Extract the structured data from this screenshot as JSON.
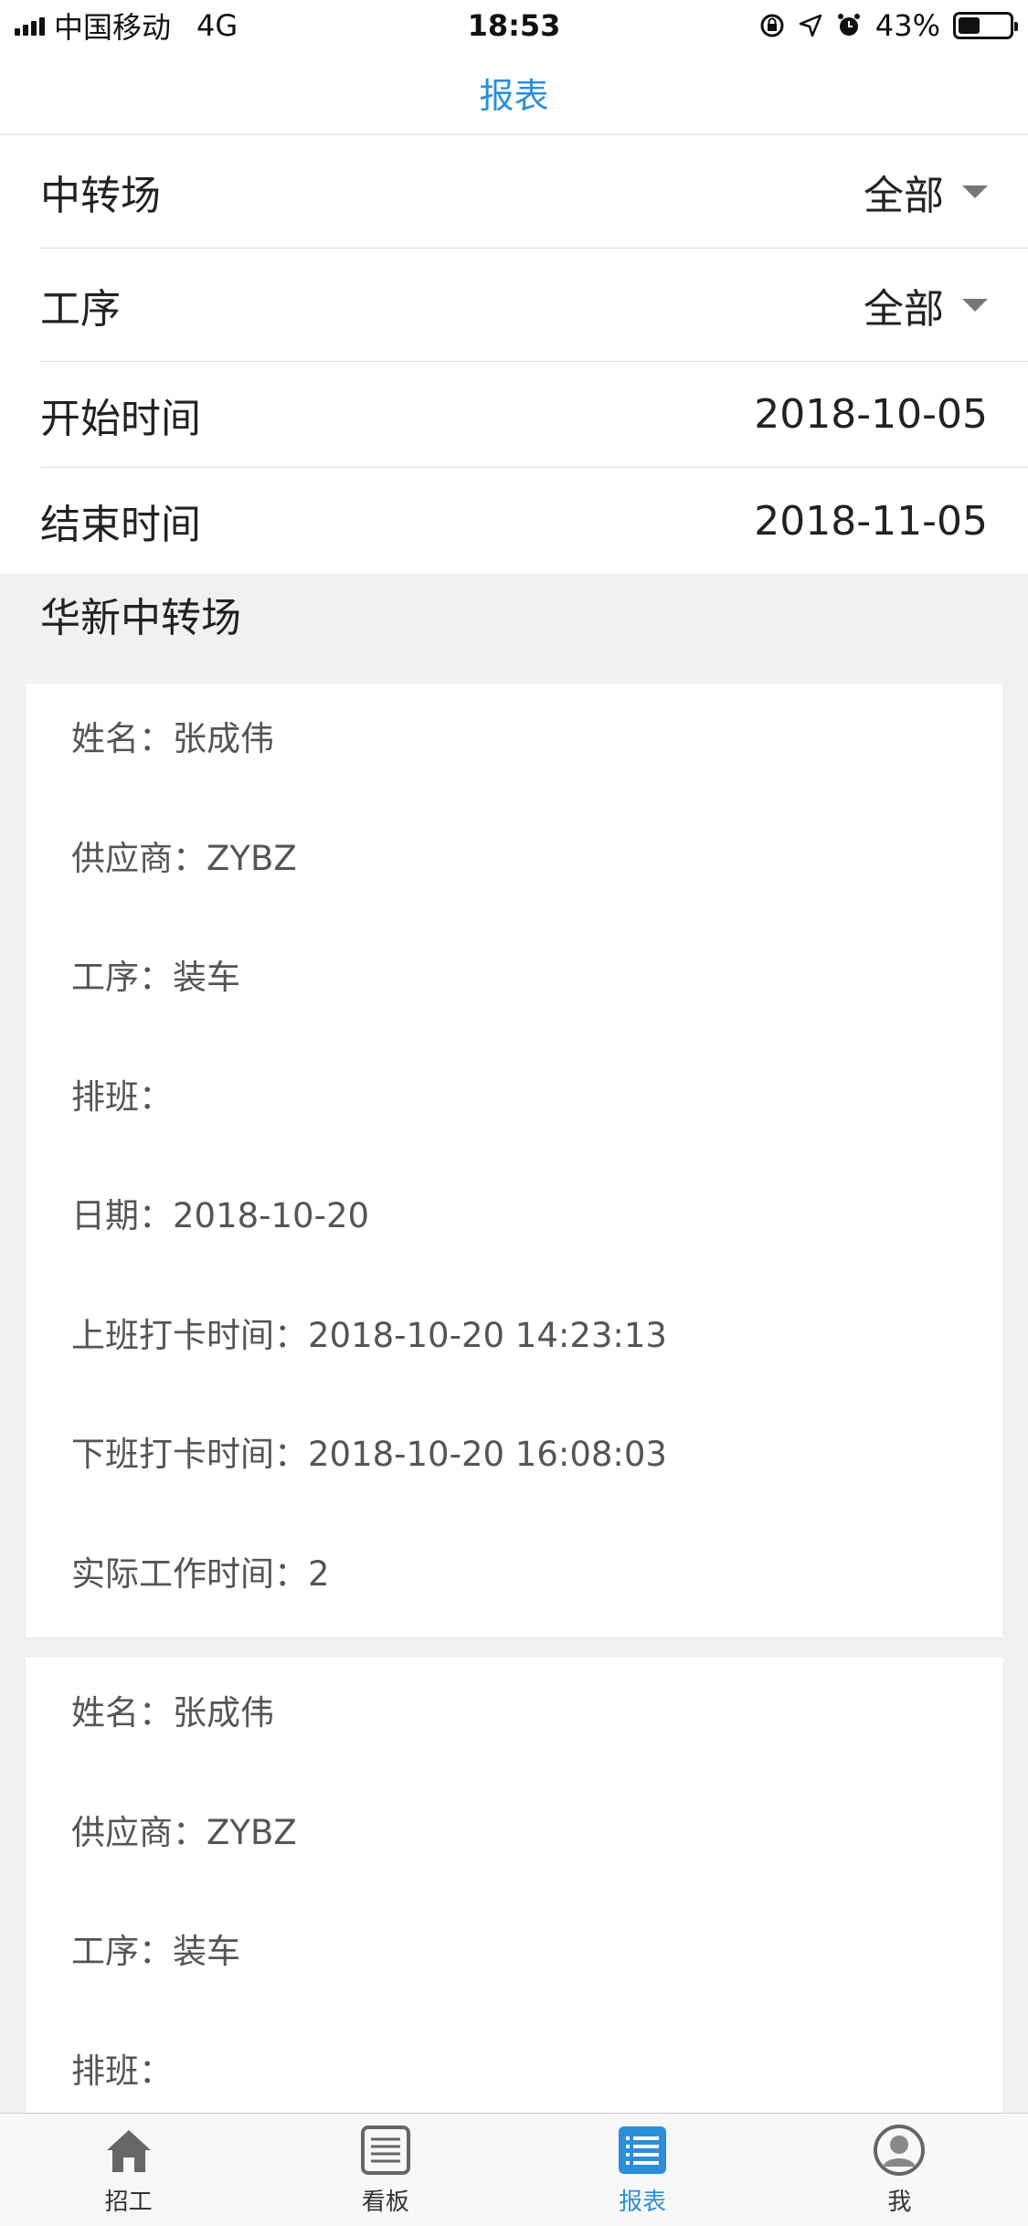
{
  "status_bar": {
    "carrier": "中国移动",
    "network": "4G",
    "time": "18:53",
    "battery": "43%",
    "battery_level": 0.43
  },
  "nav": {
    "title": "报表"
  },
  "filters": [
    {
      "label": "中转场",
      "value": "全部",
      "dropdown": true
    },
    {
      "label": "工序",
      "value": "全部",
      "dropdown": true
    },
    {
      "label": "开始时间",
      "value": "2018-10-05",
      "dropdown": false
    },
    {
      "label": "结束时间",
      "value": "2018-11-05",
      "dropdown": false
    }
  ],
  "section": {
    "title": "华新中转场"
  },
  "cards": [
    {
      "lines": [
        "姓名：张成伟",
        "供应商：ZYBZ",
        "工序：装车",
        "排班：",
        "日期：2018-10-20",
        "上班打卡时间：2018-10-20 14:23:13",
        "下班打卡时间：2018-10-20 16:08:03",
        "实际工作时间：2"
      ]
    },
    {
      "lines": [
        "姓名：张成伟",
        "供应商：ZYBZ",
        "工序：装车",
        "排班："
      ]
    }
  ],
  "tabs": [
    {
      "label": "招工",
      "icon": "home-icon",
      "active": false
    },
    {
      "label": "看板",
      "icon": "list-icon",
      "active": false
    },
    {
      "label": "报表",
      "icon": "report-icon",
      "active": true
    },
    {
      "label": "我",
      "icon": "user-icon",
      "active": false
    }
  ],
  "colors": {
    "accent": "#2b8fd8",
    "tab_inactive": "#666666"
  }
}
